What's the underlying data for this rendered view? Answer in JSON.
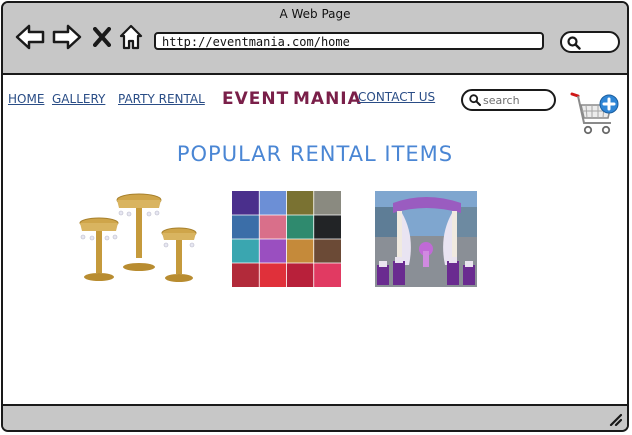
{
  "browser": {
    "title": "A Web Page",
    "url": "http://eventmania.com/home",
    "icons": [
      "back-arrow-icon",
      "forward-arrow-icon",
      "close-icon",
      "home-icon",
      "search-icon"
    ]
  },
  "site": {
    "nav": {
      "home": "HOME",
      "gallery": "GALLERY",
      "party_rental": "PARTY RENTAL",
      "contact_us": "CONTACT US"
    },
    "brand": {
      "word1": "EVENT",
      "word2": "MANIA"
    },
    "search": {
      "placeholder": "search"
    },
    "cart_icon": "add-to-cart-icon"
  },
  "main": {
    "section_title": "POPULAR RENTAL ITEMS",
    "items": [
      {
        "image": "gold-cake-stands-image"
      },
      {
        "image": "fabric-swatches-image"
      },
      {
        "image": "purple-wedding-arch-image"
      }
    ]
  },
  "colors": {
    "nav_link": "#2a4d86",
    "brand": "#7a1f49",
    "section_title": "#4a86d4",
    "chrome": "#c7c7c7"
  }
}
